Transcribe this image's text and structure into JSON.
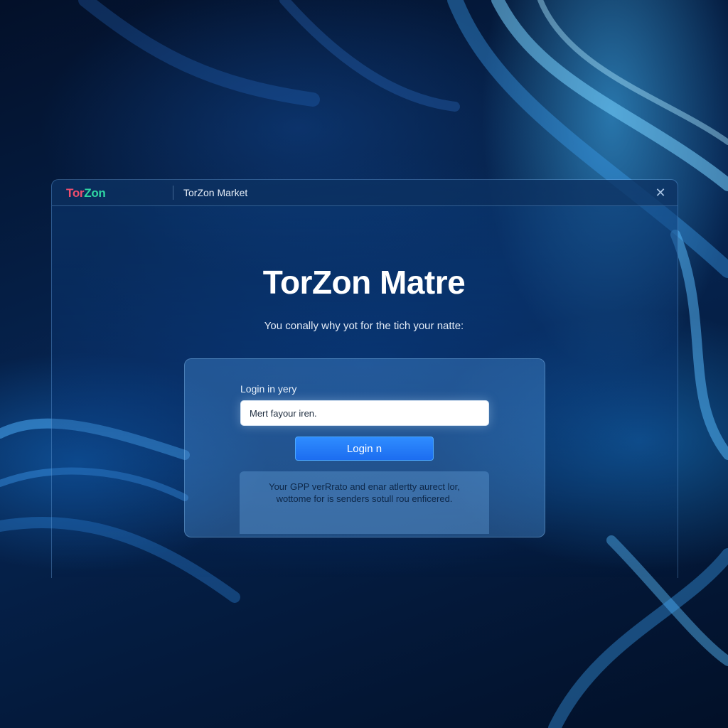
{
  "window": {
    "logo": {
      "part1": "Tor",
      "part2": "Zon"
    },
    "title": "TorZon Market",
    "close_symbol": "✕"
  },
  "hero": {
    "title": "TorZon Matre",
    "subtitle": "You conally why yot for the tich your natte:"
  },
  "login_card": {
    "label": "Login in yery",
    "input_value": "Mert fayour iren.",
    "button_label": "Login n",
    "notice_line1": "Your GPP verRrato and enar atlertty aurect lor,",
    "notice_line2": "wottome for is senders sotull rou enficered."
  },
  "icons": {
    "close": "close-icon"
  },
  "colors": {
    "logo_red": "#f04e6e",
    "logo_green": "#2fd6a3",
    "accent_blue": "#1c6df0",
    "background": "#031029"
  }
}
